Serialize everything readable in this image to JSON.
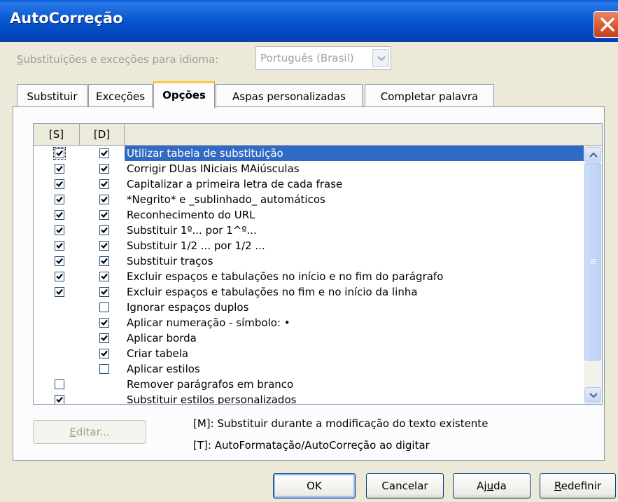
{
  "window": {
    "title": "AutoCorreção"
  },
  "language": {
    "label_prefix": "S",
    "label_rest": "ubstituições e exceções para idioma:",
    "value": "Português (Brasil)"
  },
  "tabs": [
    {
      "label": "Substituir",
      "active": false
    },
    {
      "label": "Exceções",
      "active": false
    },
    {
      "label": "Opções",
      "active": true
    },
    {
      "label": "Aspas personalizadas",
      "active": false
    },
    {
      "label": "Completar palavra",
      "active": false
    }
  ],
  "list": {
    "col_s": "[S]",
    "col_d": "[D]",
    "rows": [
      {
        "label": "Utilizar tabela de substituição",
        "s": true,
        "d": true,
        "s_shown": true,
        "d_shown": true,
        "selected": true
      },
      {
        "label": "Corrigir DUas INiciais MAiúsculas",
        "s": true,
        "d": true,
        "s_shown": true,
        "d_shown": true
      },
      {
        "label": "Capitalizar a primeira letra de cada frase",
        "s": true,
        "d": true,
        "s_shown": true,
        "d_shown": true
      },
      {
        "label": "*Negrito* e _sublinhado_ automáticos",
        "s": true,
        "d": true,
        "s_shown": true,
        "d_shown": true
      },
      {
        "label": "Reconhecimento do URL",
        "s": true,
        "d": true,
        "s_shown": true,
        "d_shown": true
      },
      {
        "label": "Substituir 1º... por 1^º...",
        "s": true,
        "d": true,
        "s_shown": true,
        "d_shown": true
      },
      {
        "label": "Substituir 1/2 ... por 1/2 ...",
        "s": true,
        "d": true,
        "s_shown": true,
        "d_shown": true
      },
      {
        "label": "Substituir traços",
        "s": true,
        "d": true,
        "s_shown": true,
        "d_shown": true
      },
      {
        "label": "Excluir espaços e tabulações no início e no fim do parágrafo",
        "s": true,
        "d": true,
        "s_shown": true,
        "d_shown": true
      },
      {
        "label": "Excluir espaços e tabulações no fim e no início da linha",
        "s": true,
        "d": true,
        "s_shown": true,
        "d_shown": true
      },
      {
        "label": "Ignorar espaços duplos",
        "s": false,
        "d": false,
        "s_shown": false,
        "d_shown": true
      },
      {
        "label": "Aplicar numeração - símbolo: •",
        "s": false,
        "d": true,
        "s_shown": false,
        "d_shown": true
      },
      {
        "label": "Aplicar borda",
        "s": false,
        "d": true,
        "s_shown": false,
        "d_shown": true
      },
      {
        "label": "Criar tabela",
        "s": false,
        "d": true,
        "s_shown": false,
        "d_shown": true
      },
      {
        "label": "Aplicar estilos",
        "s": false,
        "d": false,
        "s_shown": false,
        "d_shown": true
      },
      {
        "label": "Remover parágrafos em branco",
        "s": false,
        "d": false,
        "s_shown": true,
        "d_shown": false
      },
      {
        "label": "Substituir estilos personalizados",
        "s": true,
        "d": false,
        "s_shown": true,
        "d_shown": false
      }
    ]
  },
  "edit_button": {
    "prefix": "E",
    "rest": "ditar..."
  },
  "legend": {
    "m": "[M]: Substituir durante a modificação do texto existente",
    "t": "[T]: AutoFormatação/AutoCorreção ao digitar"
  },
  "buttons": {
    "ok": "OK",
    "cancel": "Cancelar",
    "help_a": "Aj",
    "help_u": "u",
    "help_b": "da",
    "reset_u": "R",
    "reset_rest": "edefinir"
  }
}
